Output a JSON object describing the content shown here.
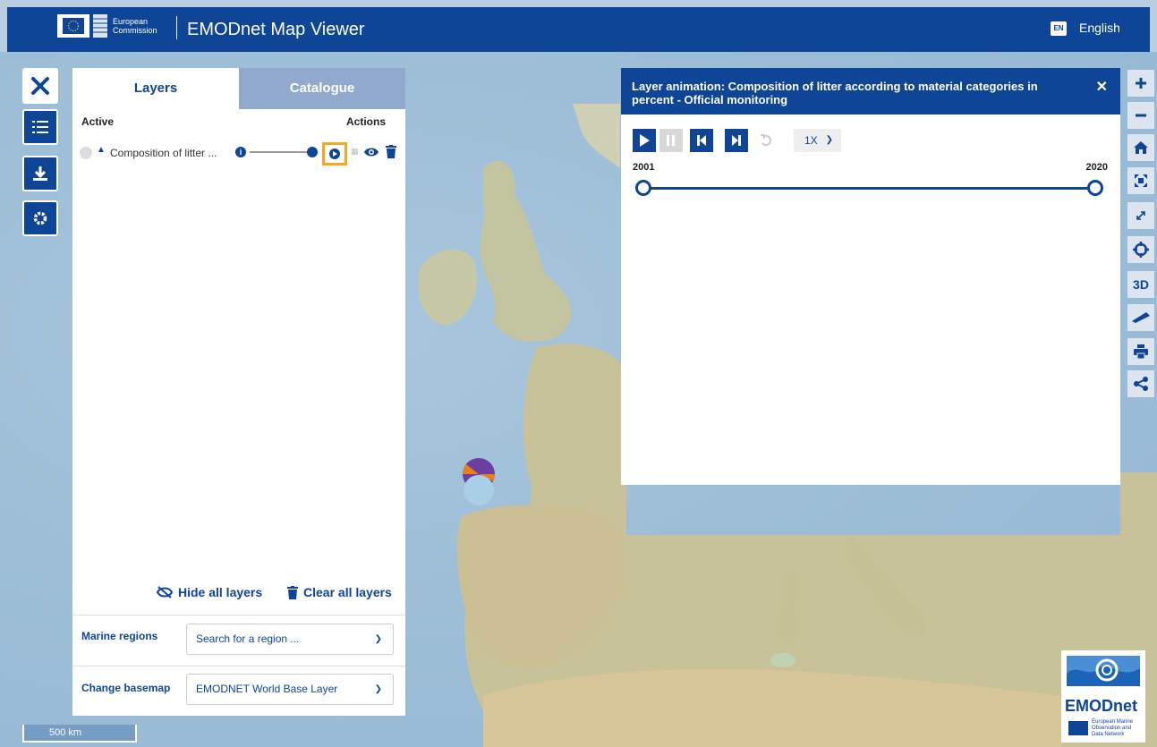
{
  "header": {
    "org_line1": "European",
    "org_line2": "Commission",
    "app_title": "EMODnet Map Viewer",
    "lang_code": "EN",
    "lang_label": "English"
  },
  "panel": {
    "tabs": [
      {
        "label": "Layers",
        "active": true
      },
      {
        "label": "Catalogue",
        "active": false
      }
    ],
    "col_active": "Active",
    "col_actions": "Actions",
    "layers": [
      {
        "name": "Composition of litter ...",
        "opacity": 1.0,
        "visible": true
      }
    ],
    "hide_all": "Hide all layers",
    "clear_all": "Clear all layers",
    "marine_regions_label": "Marine regions",
    "marine_regions_placeholder": "Search for a region ...",
    "basemap_label": "Change basemap",
    "basemap_value": "EMODNET World Base Layer"
  },
  "animation": {
    "title": "Layer animation: Composition of litter according to material categories in percent - Official monitoring",
    "speed": "1X",
    "start_year": "2001",
    "end_year": "2020"
  },
  "right_toolbar": {
    "three_d_label": "3D"
  },
  "logo": {
    "word": "EMODnet",
    "sub_line1": "European Marine",
    "sub_line2": "Observation and",
    "sub_line3": "Data Network"
  },
  "scale_label": "500 km",
  "colors": {
    "brand": "#0e4596",
    "highlight": "#f6a623",
    "tab_inactive": "#91a9cc"
  }
}
